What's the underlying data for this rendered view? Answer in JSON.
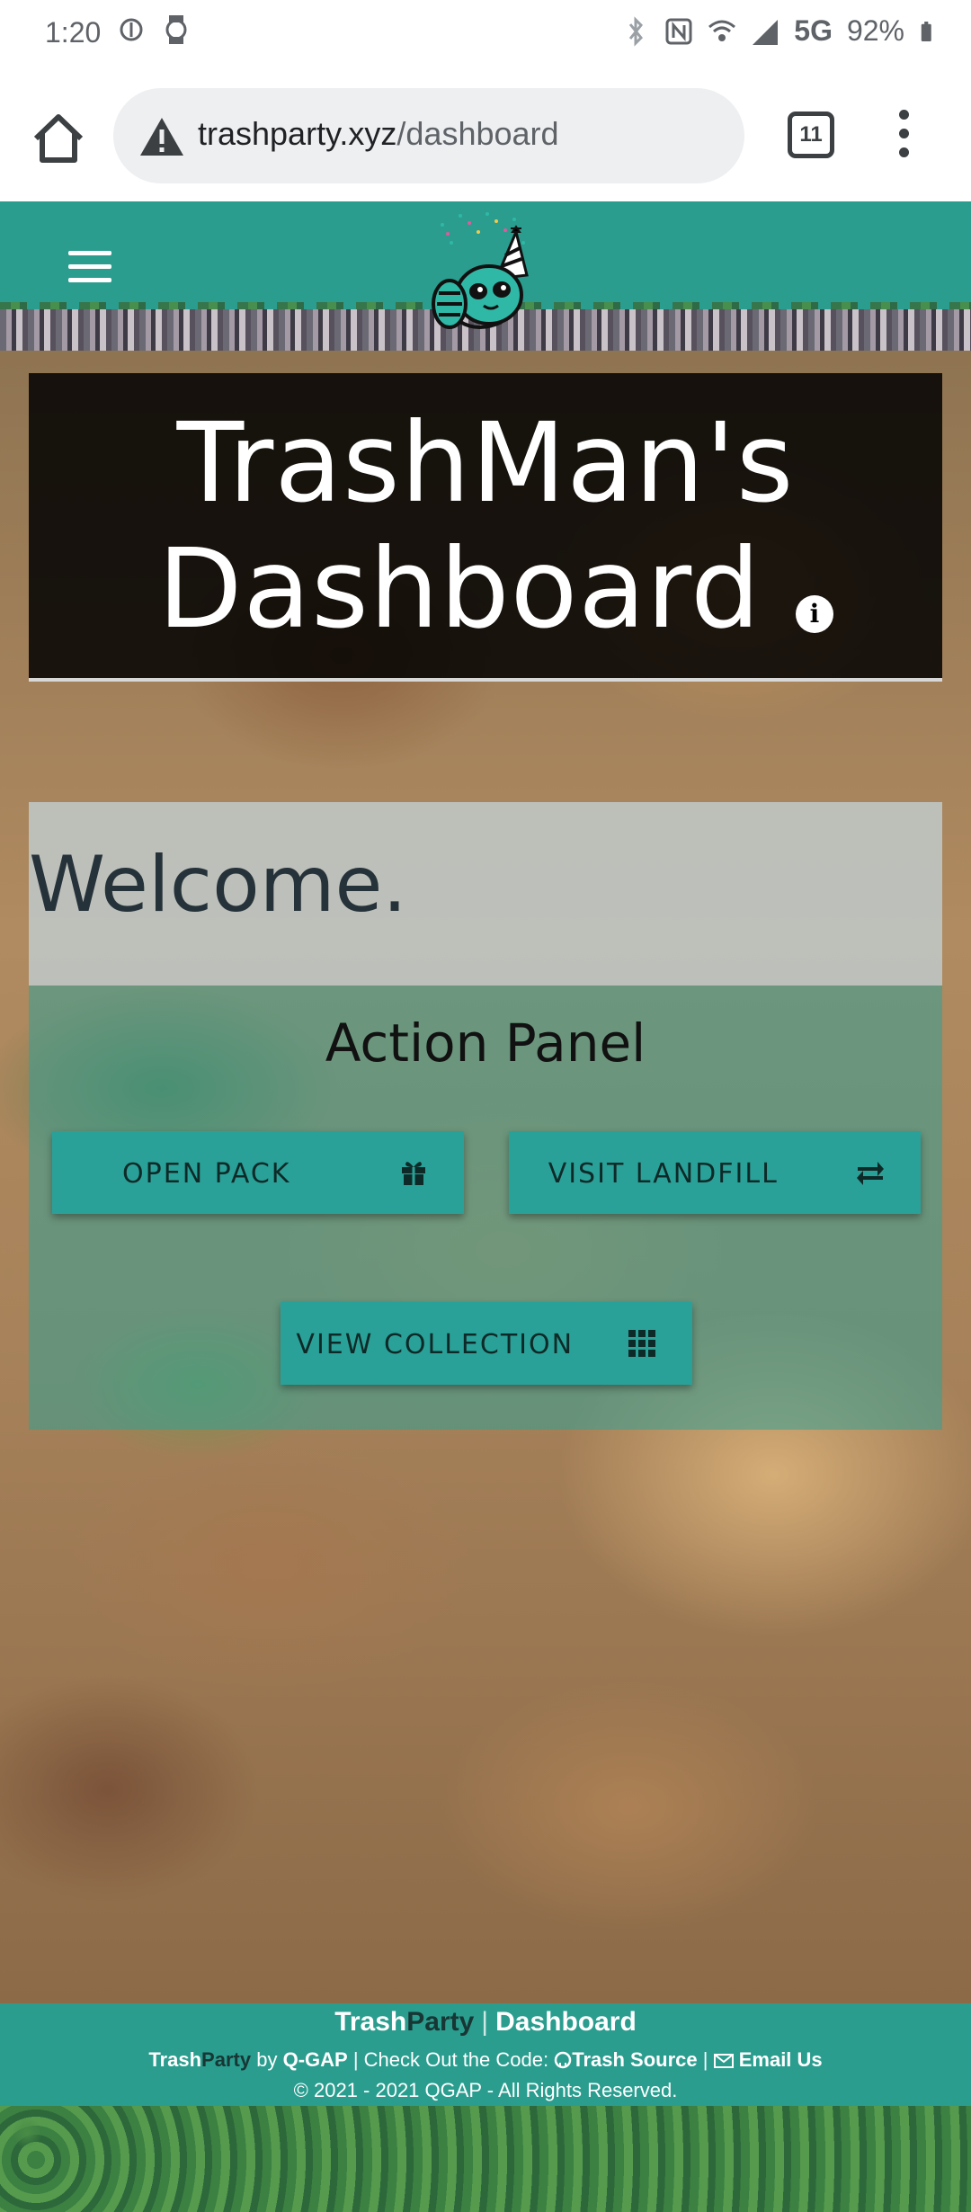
{
  "status_bar": {
    "time": "1:20",
    "network": "5G",
    "battery": "92%"
  },
  "browser": {
    "url_domain": "trashparty.xyz",
    "url_path": "/dashboard",
    "tab_count": "11"
  },
  "site": {
    "title_line1": "TrashMan's",
    "title_line2": "Dashboard",
    "info_icon": "i"
  },
  "welcome": {
    "text": "Welcome."
  },
  "action_panel": {
    "title": "Action Panel",
    "buttons": [
      {
        "label": "OPEN PACK",
        "icon": "gift-icon"
      },
      {
        "label": "VISIT LANDFILL",
        "icon": "exchange-icon"
      },
      {
        "label": "VIEW COLLECTION",
        "icon": "grid-icon"
      }
    ]
  },
  "footer": {
    "brand_trash": "Trash",
    "brand_party": "Party",
    "separator": "|",
    "page_name": "Dashboard",
    "by_text": "by",
    "org_link": "Q-GAP",
    "check_code": "| Check Out the Code:",
    "source_link": "Trash Source",
    "email_link": "Email Us",
    "copyright": "© 2021 - 2021 QGAP - All Rights Reserved."
  },
  "colors": {
    "brand_teal": "#2a9d8f",
    "button_teal": "#2aa198",
    "title_bg": "#000000"
  }
}
